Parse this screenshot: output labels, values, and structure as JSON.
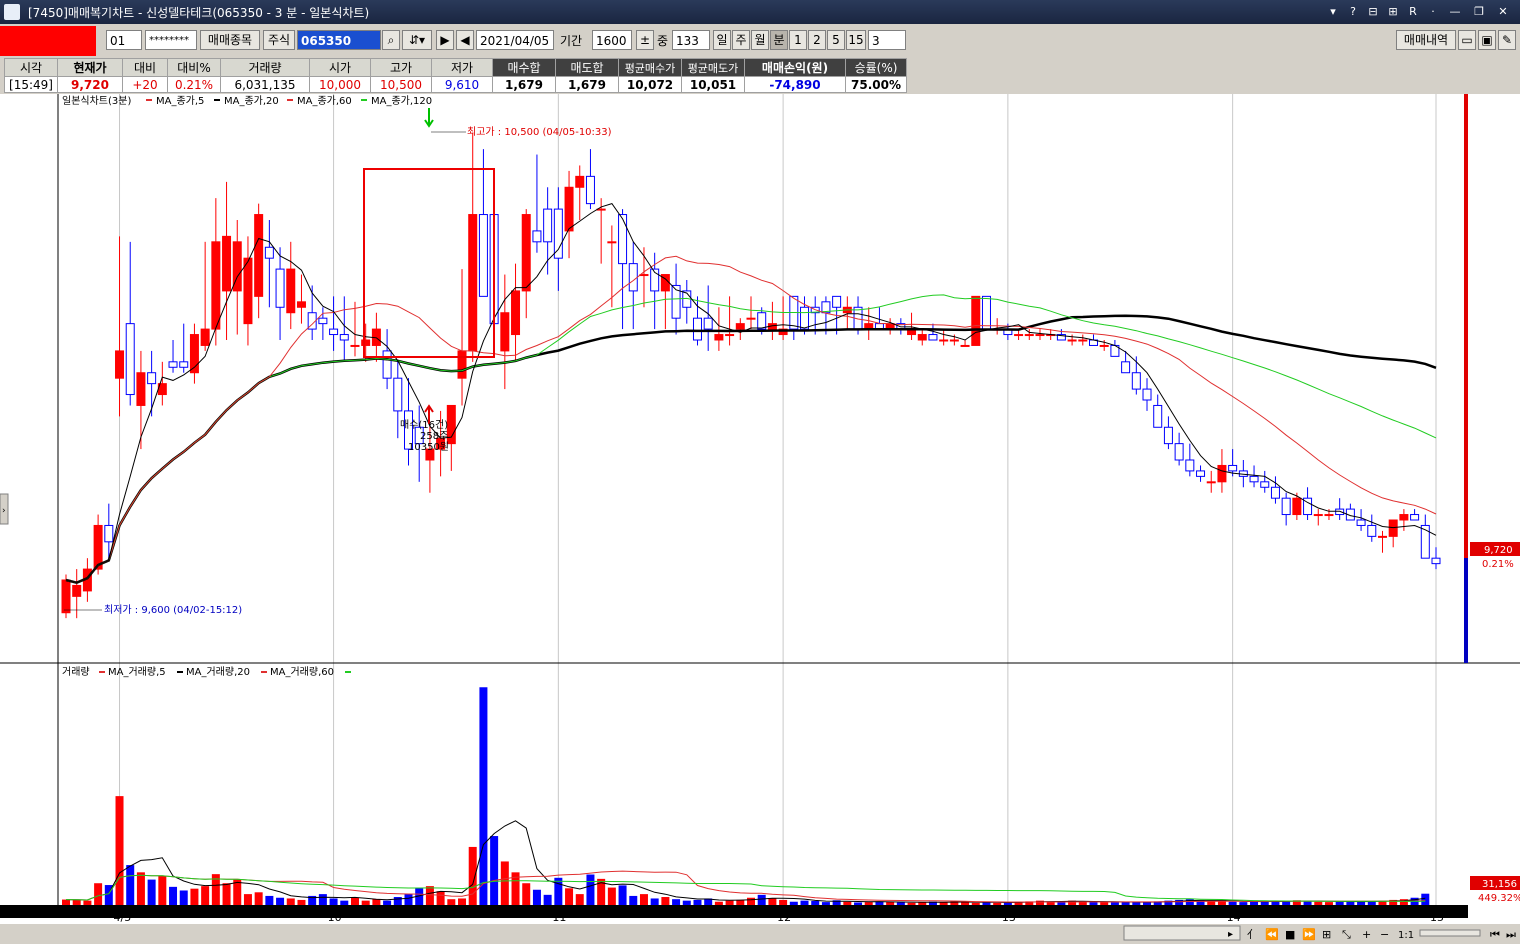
{
  "window": {
    "title": "[7450]매매복기차트 - 신성델타테크(065350 - 3 분 - 일본식차트)",
    "controls": [
      "▾",
      "?",
      "⊟",
      "⊞",
      "R",
      "·",
      "—",
      "❐",
      "✕"
    ]
  },
  "toolbar": {
    "account_select": "01",
    "password": "********",
    "trade_items_button": "매매종목",
    "stock_type": "주식",
    "code": "065350",
    "date": "2021/04/05",
    "period_label": "기간",
    "period_value": "1600",
    "mid_label": "중",
    "mid_value": "133",
    "period_tabs": [
      "일",
      "주",
      "월",
      "분",
      "1",
      "2",
      "5",
      "15"
    ],
    "minute_select": "3",
    "history_button": "매매내역"
  },
  "quote": {
    "headers": [
      "시각",
      "현재가",
      "대비",
      "대비%",
      "거래량",
      "시가",
      "고가",
      "저가",
      "매수합",
      "매도합",
      "평균매수가",
      "평균매도가",
      "매매손익(원)",
      "승률(%)"
    ],
    "values": [
      "[15:49]",
      "9,720",
      "+20",
      "0.21%",
      "6,031,135",
      "10,000",
      "10,500",
      "9,610",
      "1,679",
      "1,679",
      "10,072",
      "10,051",
      "-74,890",
      "75.00%"
    ]
  },
  "chart": {
    "price_legend": [
      "일본식차트(3분)",
      "MA_종가,5",
      "MA_종가,20",
      "MA_종가,60",
      "MA_종가,120"
    ],
    "volume_legend": [
      "거래량",
      "MA_거래량,5",
      "MA_거래량,20",
      "MA_거래량,60"
    ],
    "high_annotation": "최고가 : 10,500 (04/05-10:33)",
    "low_annotation": "최저가 : 9,600 (04/02-15:12)",
    "buy_label_1": "매수(16건)",
    "buy_label_2": "258주",
    "buy_label_3": "10350원",
    "price_box_value": "9,720",
    "price_box_pct": "0.21%",
    "volume_box_value": "31,156",
    "volume_box_pct": "449.32%",
    "x_ticks": [
      "4/5",
      "10",
      "11",
      "12",
      "13",
      "14",
      "15"
    ],
    "colors": {
      "up": "#ff0000",
      "down": "#0000ff",
      "ma5": "#000000",
      "ma20": "#e03030",
      "ma60": "#22cc22",
      "ma120": "#000000"
    }
  },
  "chart_data": {
    "type": "candlestick",
    "x_ticks": [
      "4/5",
      "10",
      "11",
      "12",
      "13",
      "14",
      "15"
    ],
    "ohlc": [
      [
        9620,
        9690,
        9610,
        9680
      ],
      [
        9650,
        9700,
        9610,
        9670
      ],
      [
        9660,
        9720,
        9640,
        9700
      ],
      [
        9700,
        9800,
        9690,
        9780
      ],
      [
        9780,
        9820,
        9720,
        9750
      ],
      [
        10050,
        10310,
        9980,
        10100
      ],
      [
        10150,
        10300,
        10000,
        10020
      ],
      [
        10000,
        10100,
        9920,
        10060
      ],
      [
        10060,
        10100,
        9980,
        10040
      ],
      [
        10020,
        10080,
        10000,
        10040
      ],
      [
        10080,
        10120,
        10060,
        10070
      ],
      [
        10080,
        10150,
        10060,
        10070
      ],
      [
        10060,
        10150,
        10040,
        10130
      ],
      [
        10110,
        10300,
        10100,
        10140
      ],
      [
        10140,
        10380,
        10110,
        10300
      ],
      [
        10210,
        10410,
        10120,
        10310
      ],
      [
        10210,
        10340,
        10130,
        10300
      ],
      [
        10150,
        10310,
        10110,
        10270
      ],
      [
        10200,
        10370,
        10160,
        10350
      ],
      [
        10290,
        10340,
        10180,
        10270
      ],
      [
        10250,
        10290,
        10120,
        10180
      ],
      [
        10170,
        10300,
        10140,
        10250
      ],
      [
        10180,
        10240,
        10150,
        10190
      ],
      [
        10170,
        10220,
        10120,
        10140
      ],
      [
        10160,
        10180,
        10120,
        10150
      ],
      [
        10140,
        10200,
        10100,
        10130
      ],
      [
        10130,
        10200,
        10080,
        10120
      ],
      [
        10110,
        10190,
        10090,
        10110
      ],
      [
        10110,
        10150,
        10080,
        10120
      ],
      [
        10110,
        10170,
        10080,
        10140
      ],
      [
        10100,
        10140,
        10030,
        10050
      ],
      [
        10050,
        10080,
        9940,
        9990
      ],
      [
        9990,
        10050,
        9890,
        9920
      ],
      [
        9960,
        10000,
        9860,
        9930
      ],
      [
        9900,
        9970,
        9840,
        9920
      ],
      [
        9920,
        9990,
        9870,
        9940
      ],
      [
        9930,
        10000,
        9880,
        10000
      ],
      [
        10050,
        10250,
        10000,
        10100
      ],
      [
        10100,
        10500,
        10080,
        10350
      ],
      [
        10350,
        10470,
        10220,
        10200
      ],
      [
        10350,
        10400,
        10120,
        10150
      ],
      [
        10100,
        10240,
        10030,
        10170
      ],
      [
        10130,
        10260,
        10080,
        10210
      ],
      [
        10210,
        10360,
        10160,
        10350
      ],
      [
        10320,
        10460,
        10280,
        10300
      ],
      [
        10360,
        10400,
        10240,
        10300
      ],
      [
        10360,
        10400,
        10210,
        10270
      ],
      [
        10320,
        10430,
        10270,
        10400
      ],
      [
        10400,
        10440,
        10340,
        10420
      ],
      [
        10420,
        10470,
        10360,
        10370
      ],
      [
        10360,
        10380,
        10260,
        10360
      ],
      [
        10300,
        10330,
        10180,
        10300
      ],
      [
        10350,
        10360,
        10140,
        10260
      ],
      [
        10260,
        10300,
        10140,
        10210
      ],
      [
        10240,
        10290,
        10180,
        10240
      ],
      [
        10250,
        10280,
        10140,
        10210
      ],
      [
        10210,
        10240,
        10140,
        10240
      ],
      [
        10220,
        10260,
        10130,
        10160
      ],
      [
        10210,
        10230,
        10150,
        10180
      ],
      [
        10160,
        10200,
        10110,
        10120
      ],
      [
        10160,
        10220,
        10100,
        10140
      ],
      [
        10120,
        10180,
        10100,
        10130
      ],
      [
        10130,
        10200,
        10110,
        10130
      ],
      [
        10140,
        10160,
        10120,
        10150
      ],
      [
        10160,
        10200,
        10140,
        10160
      ],
      [
        10170,
        10180,
        10130,
        10140
      ],
      [
        10140,
        10190,
        10120,
        10150
      ],
      [
        10130,
        10200,
        10120,
        10140
      ],
      [
        10200,
        10200,
        10120,
        10140
      ],
      [
        10180,
        10200,
        10130,
        10140
      ],
      [
        10180,
        10200,
        10130,
        10170
      ],
      [
        10190,
        10200,
        10130,
        10170
      ],
      [
        10200,
        10200,
        10130,
        10180
      ],
      [
        10170,
        10200,
        10140,
        10180
      ],
      [
        10180,
        10200,
        10130,
        10140
      ],
      [
        10140,
        10180,
        10120,
        10150
      ],
      [
        10150,
        10180,
        10140,
        10140
      ],
      [
        10140,
        10160,
        10130,
        10150
      ],
      [
        10150,
        10160,
        10130,
        10140
      ],
      [
        10130,
        10170,
        10120,
        10140
      ],
      [
        10120,
        10140,
        10110,
        10130
      ],
      [
        10130,
        10150,
        10120,
        10120
      ],
      [
        10120,
        10140,
        10110,
        10120
      ],
      [
        10120,
        10130,
        10110,
        10120
      ],
      [
        10110,
        10120,
        10110,
        10110
      ],
      [
        10110,
        10200,
        10110,
        10200
      ],
      [
        10200,
        10200,
        10140,
        10140
      ],
      [
        10140,
        10160,
        10130,
        10140
      ],
      [
        10140,
        10150,
        10120,
        10130
      ],
      [
        10130,
        10140,
        10120,
        10130
      ],
      [
        10130,
        10140,
        10120,
        10130
      ],
      [
        10130,
        10140,
        10120,
        10130
      ],
      [
        10130,
        10140,
        10120,
        10130
      ],
      [
        10130,
        10140,
        10120,
        10120
      ],
      [
        10120,
        10130,
        10110,
        10120
      ],
      [
        10120,
        10130,
        10110,
        10120
      ],
      [
        10120,
        10130,
        10110,
        10110
      ],
      [
        10110,
        10120,
        10100,
        10110
      ],
      [
        10110,
        10120,
        10090,
        10090
      ],
      [
        10080,
        10100,
        10070,
        10060
      ],
      [
        10060,
        10090,
        10020,
        10030
      ],
      [
        10030,
        10050,
        9990,
        10010
      ],
      [
        10000,
        10020,
        9960,
        9960
      ],
      [
        9960,
        9980,
        9920,
        9930
      ],
      [
        9930,
        9950,
        9890,
        9900
      ],
      [
        9900,
        9930,
        9870,
        9880
      ],
      [
        9880,
        9890,
        9860,
        9870
      ],
      [
        9860,
        9880,
        9840,
        9860
      ],
      [
        9860,
        9920,
        9840,
        9890
      ],
      [
        9890,
        9920,
        9870,
        9880
      ],
      [
        9880,
        9900,
        9850,
        9870
      ],
      [
        9870,
        9890,
        9850,
        9860
      ],
      [
        9860,
        9880,
        9840,
        9850
      ],
      [
        9850,
        9870,
        9820,
        9830
      ],
      [
        9830,
        9840,
        9780,
        9800
      ],
      [
        9800,
        9840,
        9790,
        9830
      ],
      [
        9830,
        9850,
        9790,
        9800
      ],
      [
        9800,
        9810,
        9780,
        9800
      ],
      [
        9800,
        9810,
        9790,
        9800
      ],
      [
        9810,
        9830,
        9790,
        9800
      ],
      [
        9810,
        9820,
        9790,
        9790
      ],
      [
        9790,
        9810,
        9770,
        9780
      ],
      [
        9780,
        9800,
        9750,
        9760
      ],
      [
        9760,
        9770,
        9730,
        9760
      ],
      [
        9760,
        9790,
        9740,
        9790
      ],
      [
        9790,
        9810,
        9770,
        9800
      ],
      [
        9800,
        9810,
        9790,
        9790
      ],
      [
        9780,
        9800,
        9720,
        9720
      ],
      [
        9720,
        9740,
        9700,
        9710
      ]
    ],
    "volume": [
      15000,
      14000,
      12000,
      60000,
      55000,
      300000,
      110000,
      90000,
      70000,
      80000,
      50000,
      40000,
      45000,
      52000,
      85000,
      60000,
      70000,
      30000,
      35000,
      25000,
      20000,
      18000,
      14000,
      25000,
      30000,
      18000,
      12000,
      20000,
      12000,
      16000,
      12000,
      22000,
      30000,
      46000,
      52000,
      38000,
      16000,
      18000,
      160000,
      600000,
      190000,
      120000,
      90000,
      60000,
      42000,
      28000,
      75000,
      46000,
      30000,
      84000,
      72000,
      48000,
      54000,
      25000,
      30000,
      18000,
      22000,
      16000,
      12000,
      14000,
      18000,
      9000,
      12000,
      14000,
      20000,
      28000,
      18000,
      14000,
      9000,
      12000,
      11000,
      8000,
      13000,
      9000,
      7000,
      8000,
      10000,
      9000,
      7000,
      6000,
      7000,
      9000,
      8000,
      10000,
      7000,
      6000,
      8000,
      6000,
      7000,
      9000,
      10000,
      12000,
      9000,
      8000,
      12000,
      10000,
      9000,
      8000,
      7000,
      8000,
      9000,
      8000,
      10000,
      12000,
      14000,
      16000,
      12000,
      10000,
      11000,
      9000,
      8000,
      10000,
      9000,
      12000,
      11000,
      13000,
      10000,
      9000,
      8000,
      10000,
      11000,
      9000,
      10000,
      12000,
      14000,
      16000,
      20000,
      31156
    ]
  }
}
